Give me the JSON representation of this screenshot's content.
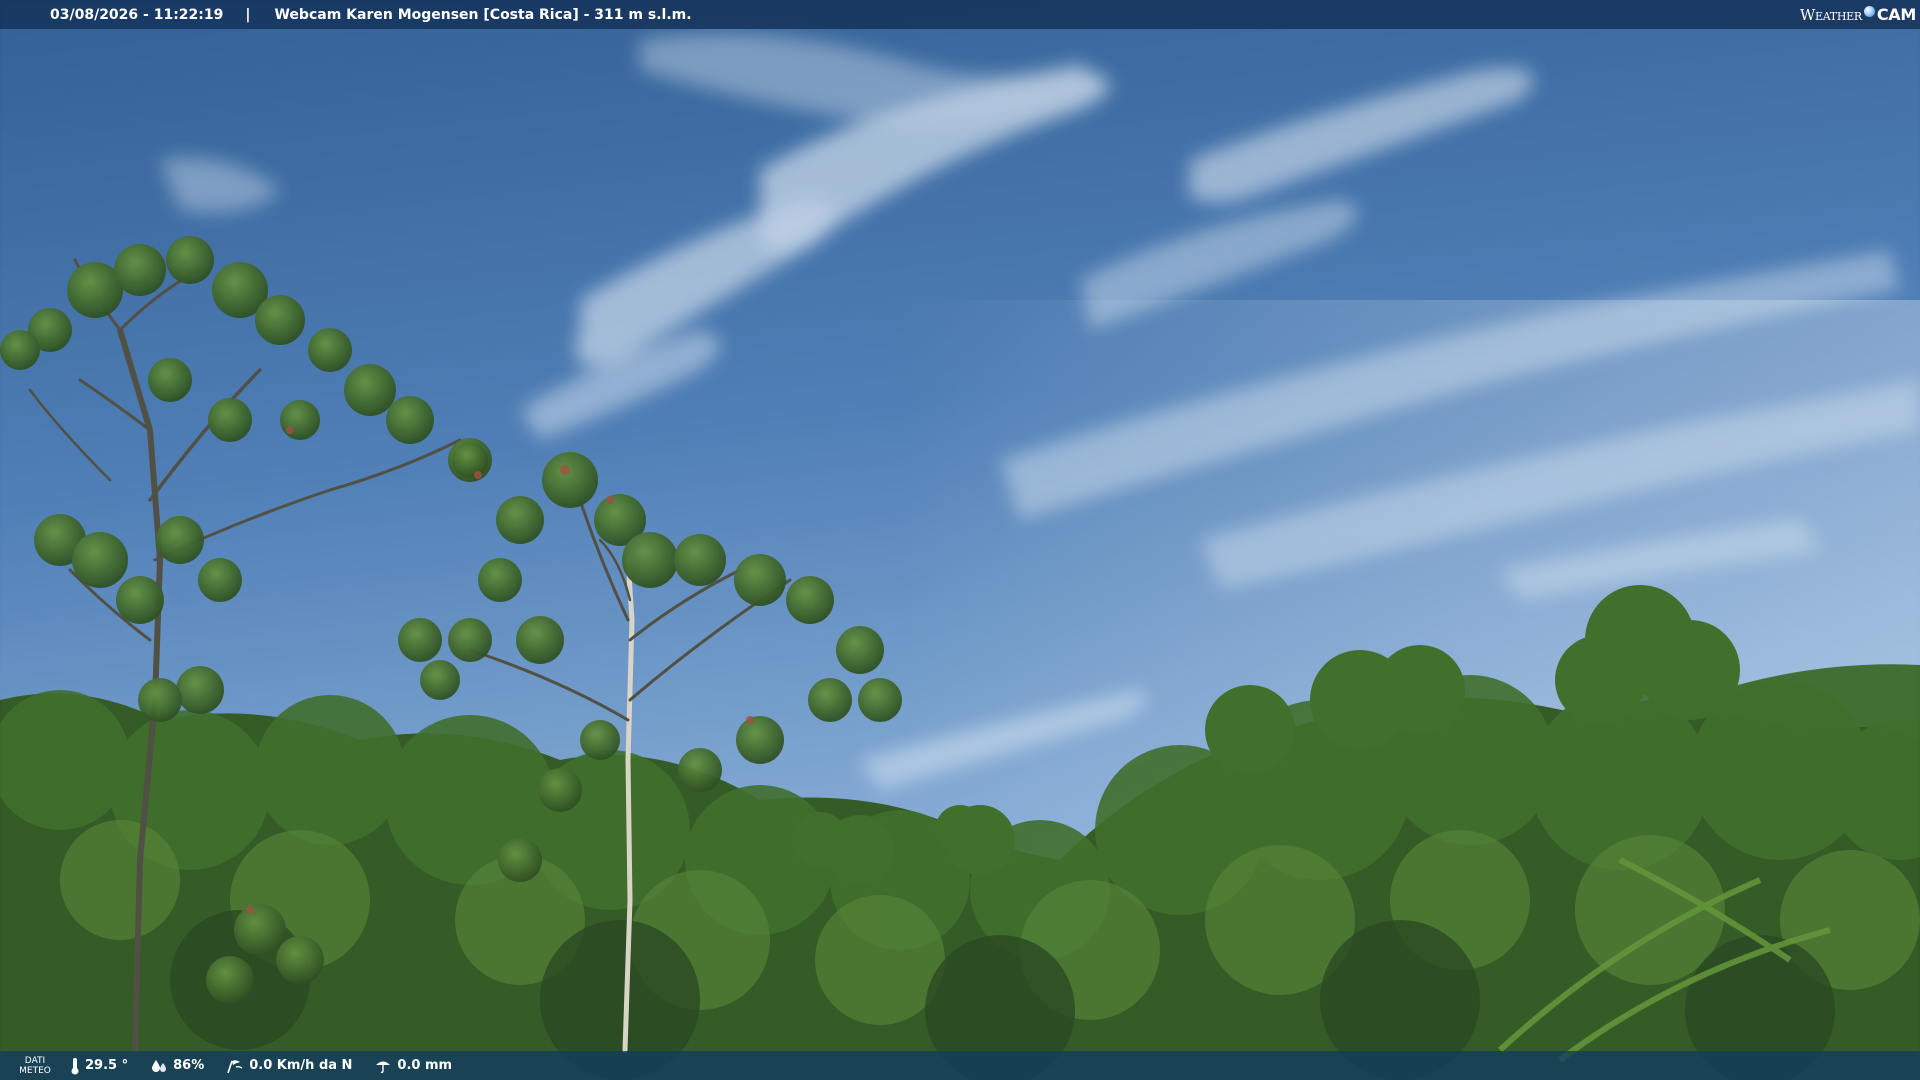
{
  "overlay": {
    "datetime": "03/08/2026 - 11:22:19",
    "separator": "|",
    "title": "Webcam Karen Mogensen [Costa Rica] - 311 m s.l.m.",
    "brand_word": "Weather",
    "brand_cam": "CAM"
  },
  "weather": {
    "label_line1": "DATI",
    "label_line2": "METEO",
    "temperature": "29.5 °",
    "humidity": "86%",
    "wind": "0.0 Km/h da N",
    "rain": "0.0 mm"
  },
  "icons": [
    "thermometer-icon",
    "humidity-icon",
    "wind-icon",
    "rain-icon",
    "brand-globe-icon"
  ],
  "colors": {
    "sky_top": "#2d5c93",
    "sky_bottom": "#86acd6",
    "foliage": "#2f5a1f",
    "bar": "#16345c"
  }
}
